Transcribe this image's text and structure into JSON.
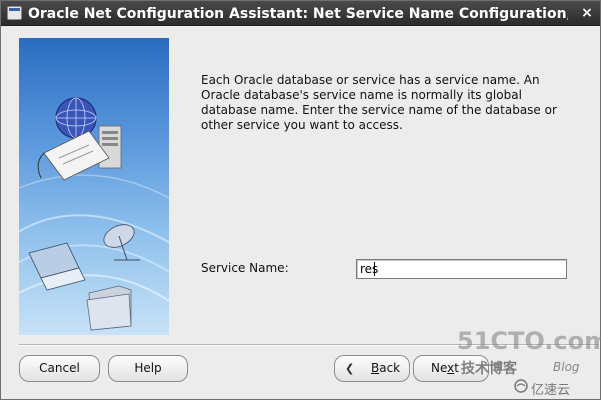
{
  "window": {
    "title": "Oracle Net Configuration Assistant: Net Service Name Configuration, Se",
    "close_glyph": "×"
  },
  "content": {
    "description": "Each Oracle database or service has a service name. An Oracle database's service name is normally its global database name. Enter the service name of the database or other service you want to access.",
    "service_name_label": "Service Name:",
    "service_name_value": "res"
  },
  "buttons": {
    "cancel": "Cancel",
    "help": "Help",
    "back_prefix": "",
    "back_mnemonic": "B",
    "back_rest": "ack",
    "next_prefix": "Ne",
    "next_mnemonic": "x",
    "next_rest": "t"
  },
  "watermark": {
    "main": "51CTO.com",
    "sub": "技术博客",
    "blog": "Blog",
    "cloud": "亿速云"
  },
  "icons": {
    "title": "window-app-icon",
    "banner": "network-services-illustration",
    "back": "back-arrow-icon"
  },
  "colors": {
    "titlebar": "#2b2b2b",
    "banner_top": "#2a6cc0",
    "banner_bottom": "#c7e2f7"
  }
}
